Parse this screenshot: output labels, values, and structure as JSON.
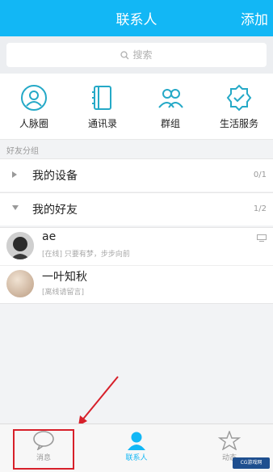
{
  "header": {
    "title": "联系人",
    "action": "添加"
  },
  "search": {
    "placeholder": "搜索"
  },
  "shortcuts": [
    {
      "label": "人脉圈",
      "icon": "people-circle-icon"
    },
    {
      "label": "通讯录",
      "icon": "address-book-icon"
    },
    {
      "label": "群组",
      "icon": "group-icon"
    },
    {
      "label": "生活服务",
      "icon": "life-service-icon"
    }
  ],
  "section_label": "好友分组",
  "groups": [
    {
      "name": "我的设备",
      "count": "0/1",
      "expanded": false
    },
    {
      "name": "我的好友",
      "count": "1/2",
      "expanded": true
    }
  ],
  "friends": [
    {
      "name": "ae",
      "status": "[在线] 只要有梦，步步向前"
    },
    {
      "name": "一叶知秋",
      "status": "[离线请留言]"
    }
  ],
  "tabs": [
    {
      "label": "消息",
      "icon": "message-bubble-icon"
    },
    {
      "label": "联系人",
      "icon": "contacts-person-icon",
      "active": true
    },
    {
      "label": "动态",
      "icon": "star-icon"
    }
  ],
  "watermark": "CG游戏网",
  "colors": {
    "accent": "#12b7f5",
    "icon_teal": "#25a9c7",
    "annotation_red": "#d7202a"
  }
}
